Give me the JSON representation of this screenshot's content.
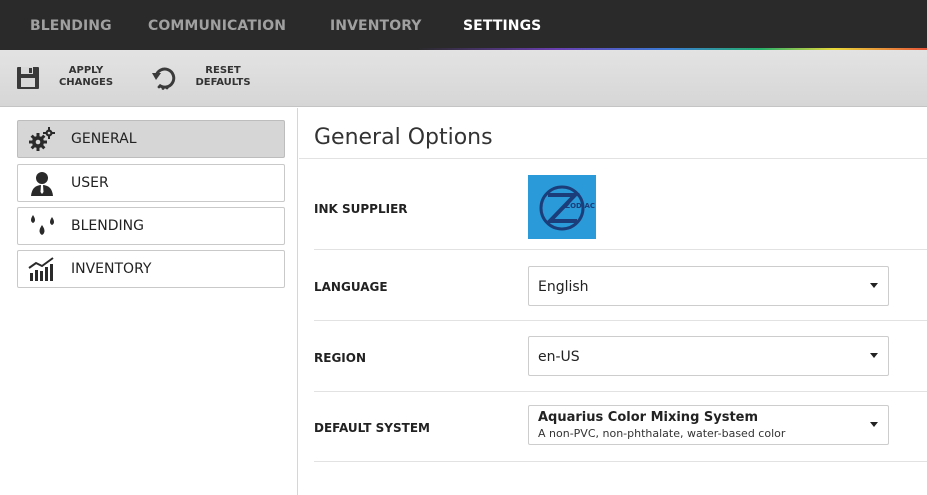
{
  "nav": {
    "tabs": [
      {
        "label": "BLENDING"
      },
      {
        "label": "COMMUNICATION"
      },
      {
        "label": "INVENTORY"
      },
      {
        "label": "SETTINGS"
      }
    ],
    "active_tab": "SETTINGS"
  },
  "toolbar": {
    "apply": {
      "line1": "APPLY",
      "line2": "CHANGES",
      "icon": "save-icon"
    },
    "reset": {
      "line1": "RESET",
      "line2": "DEFAULTS",
      "icon": "reset-icon"
    }
  },
  "sidebar": {
    "items": [
      {
        "label": "GENERAL",
        "icon": "gears-icon",
        "active": true
      },
      {
        "label": "USER",
        "icon": "user-icon",
        "active": false
      },
      {
        "label": "BLENDING",
        "icon": "drops-icon",
        "active": false
      },
      {
        "label": "INVENTORY",
        "icon": "chart-icon",
        "active": false
      }
    ]
  },
  "main": {
    "title": "General Options",
    "rows": {
      "ink_supplier": {
        "label": "INK SUPPLIER",
        "logo_text": "ZODIAC"
      },
      "language": {
        "label": "LANGUAGE",
        "value": "English"
      },
      "region": {
        "label": "REGION",
        "value": "en-US"
      },
      "default_system": {
        "label": "DEFAULT SYSTEM",
        "value_title": "Aquarius Color Mixing System",
        "value_sub": "A non-PVC, non-phthalate, water-based color"
      }
    }
  },
  "colors": {
    "nav_bg": "#2a2a2a",
    "tab_inactive": "#a0a0a0",
    "tab_active": "#ffffff",
    "logo_bg": "#2a9ad8",
    "sidebar_active_bg": "#d6d6d6"
  }
}
